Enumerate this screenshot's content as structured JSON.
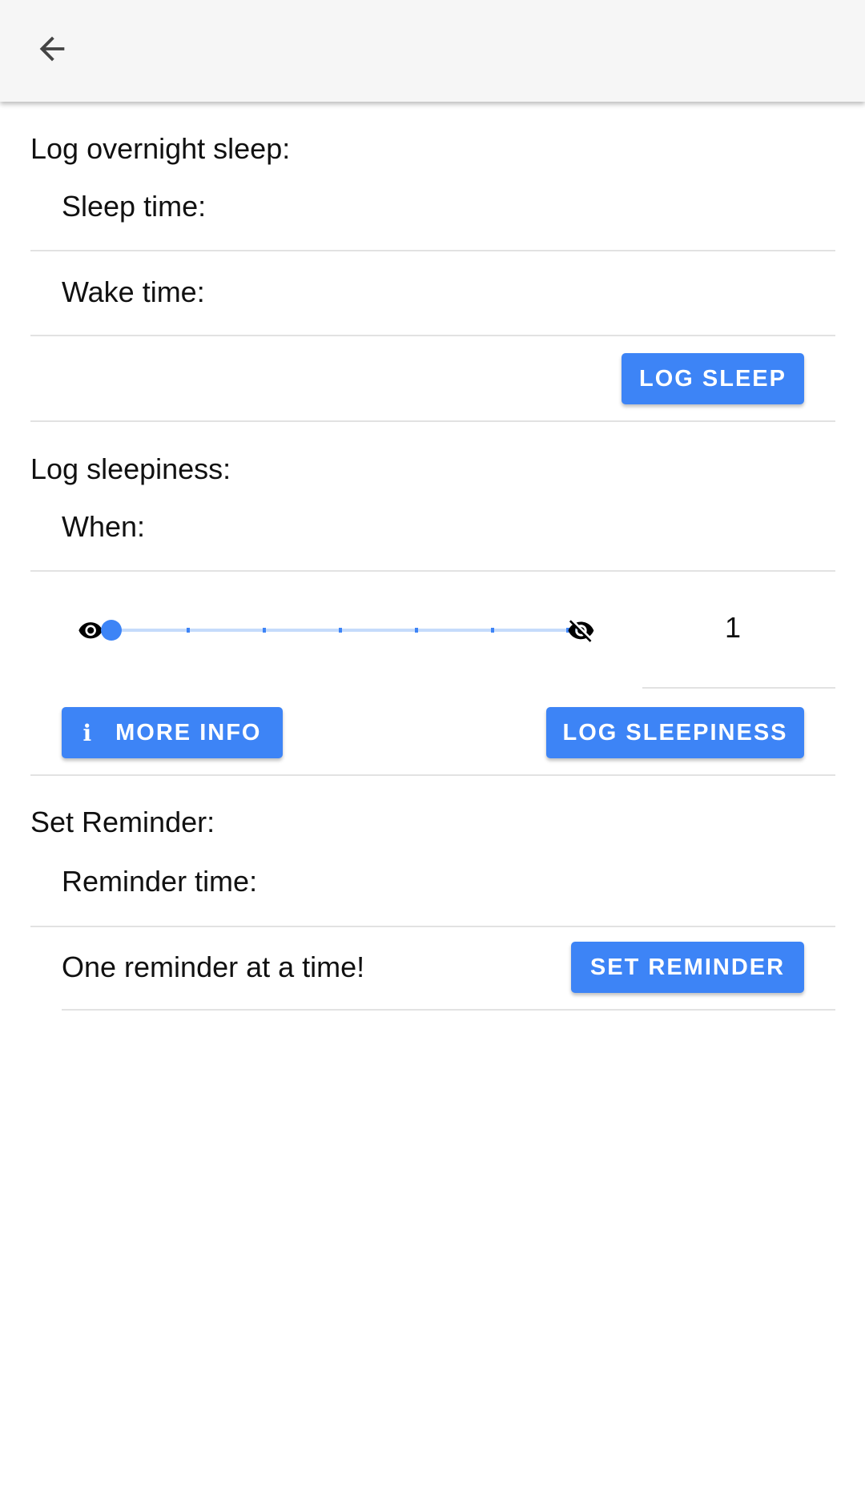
{
  "app_bar": {
    "back_icon": "arrow-back-icon"
  },
  "sleep_section": {
    "title": "Log overnight sleep:",
    "sleep_time_label": "Sleep time:",
    "wake_time_label": "Wake time:",
    "log_button": "LOG SLEEP"
  },
  "sleepiness_section": {
    "title": "Log sleepiness:",
    "when_label": "When:",
    "slider": {
      "min_icon": "eye-icon",
      "max_icon": "eye-off-icon",
      "min": 1,
      "max": 7,
      "value": 1,
      "value_label": "1"
    },
    "more_info_button": "MORE INFO",
    "more_info_icon": "info-icon",
    "log_button": "LOG SLEEPINESS"
  },
  "reminder_section": {
    "title": "Set Reminder:",
    "time_label": "Reminder time:",
    "note": "One reminder at a time!",
    "set_button": "SET REMINDER"
  },
  "colors": {
    "accent": "#3d84f6",
    "slider_track": "#c5dbfb",
    "divider": "#e2e2e2",
    "app_bar_bg": "#f6f6f6"
  }
}
